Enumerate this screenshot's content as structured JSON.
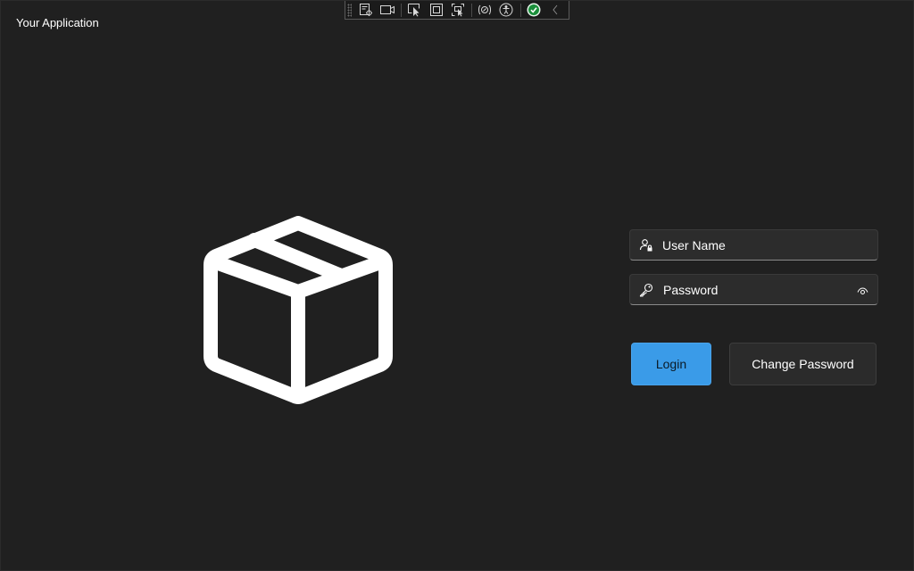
{
  "window": {
    "title": "Your Application"
  },
  "debug_toolbar": {
    "icons": [
      "live-visual-tree-icon",
      "video-camera-icon",
      "select-element-icon",
      "display-layout-adorners-icon",
      "track-focus-icon",
      "hot-reload-icon",
      "accessibility-icon",
      "binding-failures-ok-icon",
      "collapse-toolbar-icon"
    ]
  },
  "logo": {
    "icon": "package-box-icon"
  },
  "login_form": {
    "username": {
      "placeholder": "User Name",
      "value": "",
      "icon": "person-lock-icon"
    },
    "password": {
      "placeholder": "Password",
      "value": "",
      "icon": "key-icon",
      "reveal_icon": "eye-icon"
    },
    "login_label": "Login",
    "change_password_label": "Change Password"
  },
  "colors": {
    "background": "#202020",
    "accent": "#3a9be8",
    "field_background": "#2c2c2c",
    "text": "#ffffff",
    "status_ok": "#1a8f3a"
  }
}
